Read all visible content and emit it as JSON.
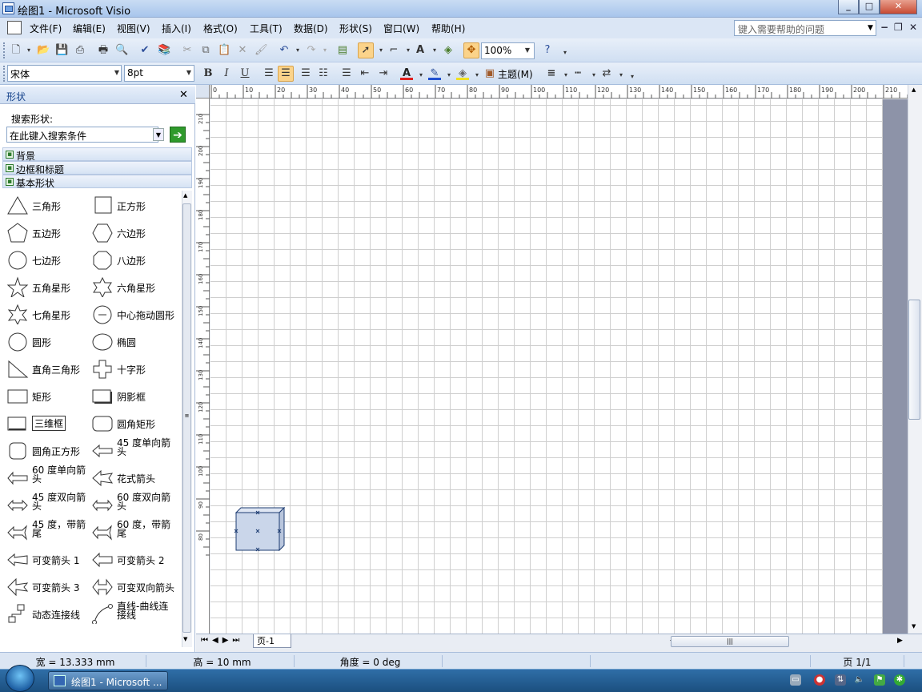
{
  "window": {
    "title": "绘图1 - Microsoft Visio"
  },
  "menu": {
    "items": [
      "文件(F)",
      "编辑(E)",
      "视图(V)",
      "插入(I)",
      "格式(O)",
      "工具(T)",
      "数据(D)",
      "形状(S)",
      "窗口(W)",
      "帮助(H)"
    ],
    "help_placeholder": "键入需要帮助的问题"
  },
  "toolbar": {
    "zoom": "100%"
  },
  "format_toolbar": {
    "font": "宋体",
    "size": "8pt",
    "bold": "B",
    "italic": "I",
    "underline": "U",
    "theme": "主题(M)"
  },
  "panel": {
    "title": "形状",
    "search_label": "搜索形状:",
    "search_placeholder": "在此键入搜索条件",
    "stencils": [
      "背景",
      "边框和标题",
      "基本形状"
    ],
    "shapes": [
      [
        "三角形",
        "正方形"
      ],
      [
        "五边形",
        "六边形"
      ],
      [
        "七边形",
        "八边形"
      ],
      [
        "五角星形",
        "六角星形"
      ],
      [
        "七角星形",
        "中心拖动圆形"
      ],
      [
        "圆形",
        "椭圆"
      ],
      [
        "直角三角形",
        "十字形"
      ],
      [
        "矩形",
        "阴影框"
      ],
      [
        "三维框",
        "圆角矩形"
      ],
      [
        "圆角正方形",
        "45 度单向箭头"
      ],
      [
        "60 度单向箭头",
        "花式箭头"
      ],
      [
        "45 度双向箭头",
        "60 度双向箭头"
      ],
      [
        "45 度，带箭尾",
        "60 度，带箭尾"
      ],
      [
        "可变箭头 1",
        "可变箭头 2"
      ],
      [
        "可变箭头 3",
        "可变双向箭头"
      ],
      [
        "动态连接线",
        "直线-曲线连接线"
      ]
    ]
  },
  "ruler": {
    "h_ticks": [
      "0",
      "10",
      "20",
      "30",
      "40",
      "50",
      "60",
      "70",
      "80",
      "90",
      "100",
      "110",
      "120",
      "130",
      "140",
      "150",
      "160",
      "170",
      "180",
      "190",
      "200",
      "210"
    ],
    "v_ticks": [
      "210",
      "200",
      "190",
      "180",
      "170",
      "160",
      "150",
      "140",
      "130",
      "120",
      "110",
      "100",
      "90",
      "80"
    ]
  },
  "pages": {
    "tab": "页-1"
  },
  "status": {
    "width": "宽 = 13.333 mm",
    "height": "高 = 10 mm",
    "angle": "角度 = 0 deg",
    "page": "页 1/1"
  },
  "taskbar": {
    "visio_task": "绘图1 - Microsoft ..."
  }
}
